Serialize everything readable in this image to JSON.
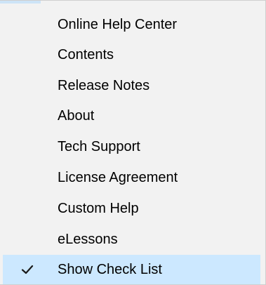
{
  "menu": {
    "items": [
      {
        "label": "Online Help Center",
        "checked": false
      },
      {
        "label": "Contents",
        "checked": false
      },
      {
        "label": "Release Notes",
        "checked": false
      },
      {
        "label": "About",
        "checked": false
      },
      {
        "label": "Tech Support",
        "checked": false
      },
      {
        "label": "License Agreement",
        "checked": false
      },
      {
        "label": "Custom Help",
        "checked": false
      },
      {
        "label": "eLessons",
        "checked": false
      },
      {
        "label": "Show Check List",
        "checked": true,
        "icon": "checkmark-icon"
      }
    ]
  },
  "colors": {
    "menu_background": "#f2f2f2",
    "checked_highlight": "#cce8ff",
    "checkmark": "#1a1a1a"
  }
}
